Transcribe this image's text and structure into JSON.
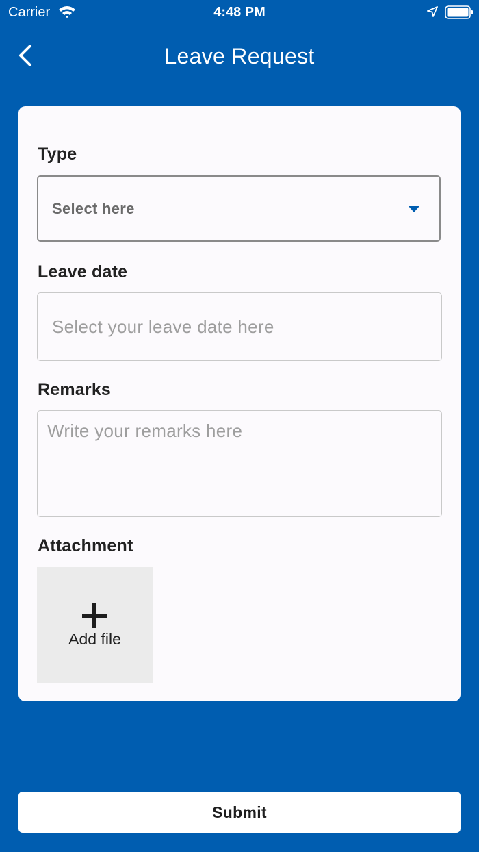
{
  "status_bar": {
    "carrier": "Carrier",
    "time": "4:48 PM",
    "icons": [
      "wifi-icon",
      "location-icon",
      "battery-icon"
    ]
  },
  "nav": {
    "title": "Leave Request",
    "back_icon": "chevron-left-icon"
  },
  "form": {
    "type": {
      "label": "Type",
      "value": "Select here",
      "icon": "dropdown-arrow-icon"
    },
    "leave_date": {
      "label": "Leave date",
      "placeholder": "Select your leave date here",
      "value": ""
    },
    "remarks": {
      "label": "Remarks",
      "placeholder": "Write your remarks here",
      "value": ""
    },
    "attachment": {
      "label": "Attachment",
      "add_file_label": "Add file",
      "icon": "plus-icon"
    }
  },
  "submit": {
    "label": "Submit"
  },
  "colors": {
    "primary": "#005db0",
    "card_background": "#fcfafd",
    "button_background": "#ffffff",
    "tile_background": "#ebebeb"
  }
}
